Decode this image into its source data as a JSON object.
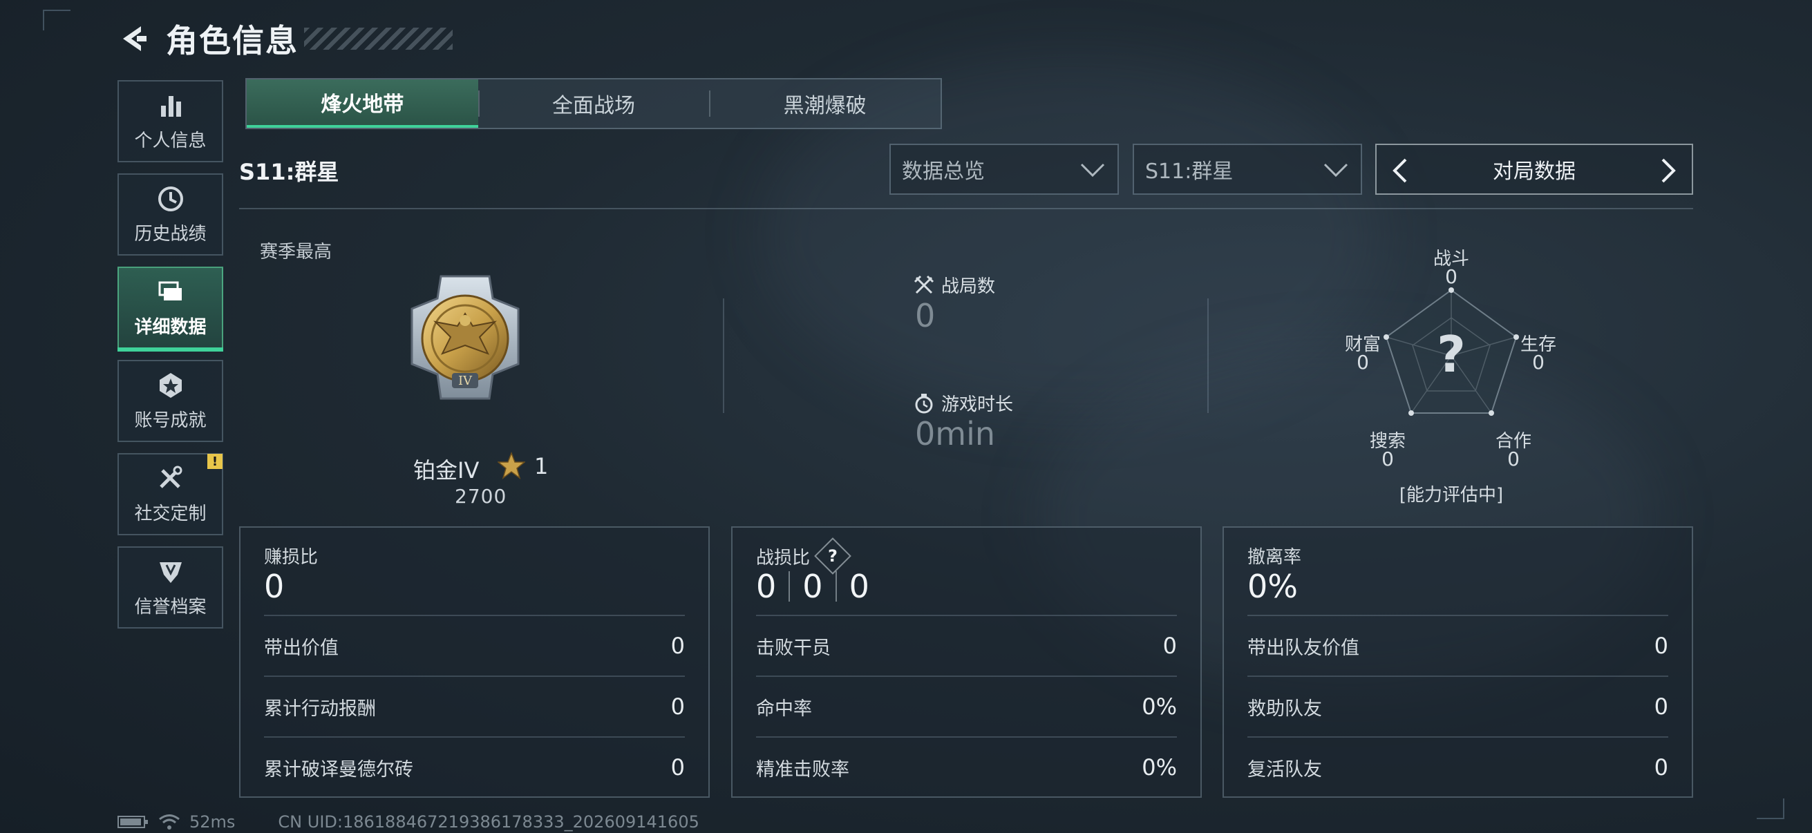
{
  "header": {
    "title": "角色信息"
  },
  "sidebar": {
    "items": [
      {
        "label": "个人信息",
        "icon": "bar-chart-icon"
      },
      {
        "label": "历史战绩",
        "icon": "clock-history-icon"
      },
      {
        "label": "详细数据",
        "icon": "stacked-cards-icon",
        "active": true
      },
      {
        "label": "账号成就",
        "icon": "badge-achievement-icon"
      },
      {
        "label": "社交定制",
        "icon": "tools-icon",
        "badge": "!"
      },
      {
        "label": "信誉档案",
        "icon": "shield-emblem-icon"
      }
    ]
  },
  "tabs": [
    {
      "label": "烽火地带",
      "active": true
    },
    {
      "label": "全面战场"
    },
    {
      "label": "黑潮爆破"
    }
  ],
  "season": {
    "label": "S11:群星",
    "dropdown_overview": "数据总览",
    "dropdown_season": "S11:群星",
    "pager_label": "对局数据"
  },
  "rank": {
    "section_label": "赛季最高",
    "name": "铂金IV",
    "stars": "1",
    "score": "2700"
  },
  "stats": {
    "matches_label": "战局数",
    "matches_value": "0",
    "playtime_label": "游戏时长",
    "playtime_value": "0min"
  },
  "radar": {
    "center_mark": "?",
    "status": "[能力评估中]",
    "axes": [
      {
        "label": "战斗",
        "value": "0"
      },
      {
        "label": "生存",
        "value": "0"
      },
      {
        "label": "合作",
        "value": "0"
      },
      {
        "label": "搜索",
        "value": "0"
      },
      {
        "label": "财富",
        "value": "0"
      }
    ]
  },
  "panels": {
    "left": {
      "title": "赚损比",
      "big": "0",
      "rows": [
        {
          "label": "带出价值",
          "value": "0"
        },
        {
          "label": "累计行动报酬",
          "value": "0"
        },
        {
          "label": "累计破译曼德尔砖",
          "value": "0"
        }
      ]
    },
    "middle": {
      "title": "战损比",
      "help": "?",
      "big_values": [
        "0",
        "0",
        "0"
      ],
      "rows": [
        {
          "label": "击败干员",
          "value": "0"
        },
        {
          "label": "命中率",
          "value": "0%"
        },
        {
          "label": "精准击败率",
          "value": "0%"
        }
      ]
    },
    "right": {
      "title": "撤离率",
      "big": "0%",
      "rows": [
        {
          "label": "带出队友价值",
          "value": "0"
        },
        {
          "label": "救助队友",
          "value": "0"
        },
        {
          "label": "复活队友",
          "value": "0"
        }
      ]
    }
  },
  "footer": {
    "ping": "52ms",
    "uid": "CN UID:1861884672193861783​33_202609141605"
  },
  "colors": {
    "accent_green": "#3fd29a",
    "active_tab": "#3b6c5c",
    "warning": "#e8c64a",
    "medal_gold": "#c9a14a"
  }
}
